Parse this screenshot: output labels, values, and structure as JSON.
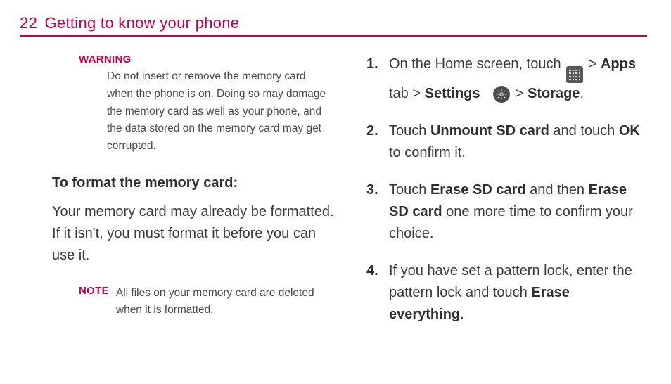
{
  "header": {
    "page_number": "22",
    "chapter_title": "Getting to know your phone"
  },
  "left": {
    "warning": {
      "label": "WARNING",
      "body": "Do not insert or remove the memory card when the phone is on. Doing so may damage the memory card as well as your phone, and the data stored on the memory card may get corrupted."
    },
    "subheading": "To format the memory card:",
    "intro": "Your memory card may already be formatted. If it isn't, you must format it before you can use it.",
    "note": {
      "label": "NOTE",
      "body": "All files on your memory card are deleted when it is formatted."
    }
  },
  "right": {
    "steps": {
      "s1": {
        "a": "On the Home screen, touch ",
        "b": " > ",
        "apps": "Apps",
        "c": " tab > ",
        "settings": "Settings",
        "d": " > ",
        "storage": "Storage",
        "e": "."
      },
      "s2": {
        "a": "Touch ",
        "unmount": "Unmount SD card",
        "b": " and touch ",
        "ok": "OK",
        "c": " to confirm it."
      },
      "s3": {
        "a": "Touch ",
        "erase1": "Erase SD card",
        "b": " and then ",
        "erase2": "Erase SD card",
        "c": " one more time to confirm your choice."
      },
      "s4": {
        "a": "If you have set a pattern lock, enter the pattern lock and touch ",
        "erase_all": "Erase everything",
        "b": "."
      }
    }
  }
}
